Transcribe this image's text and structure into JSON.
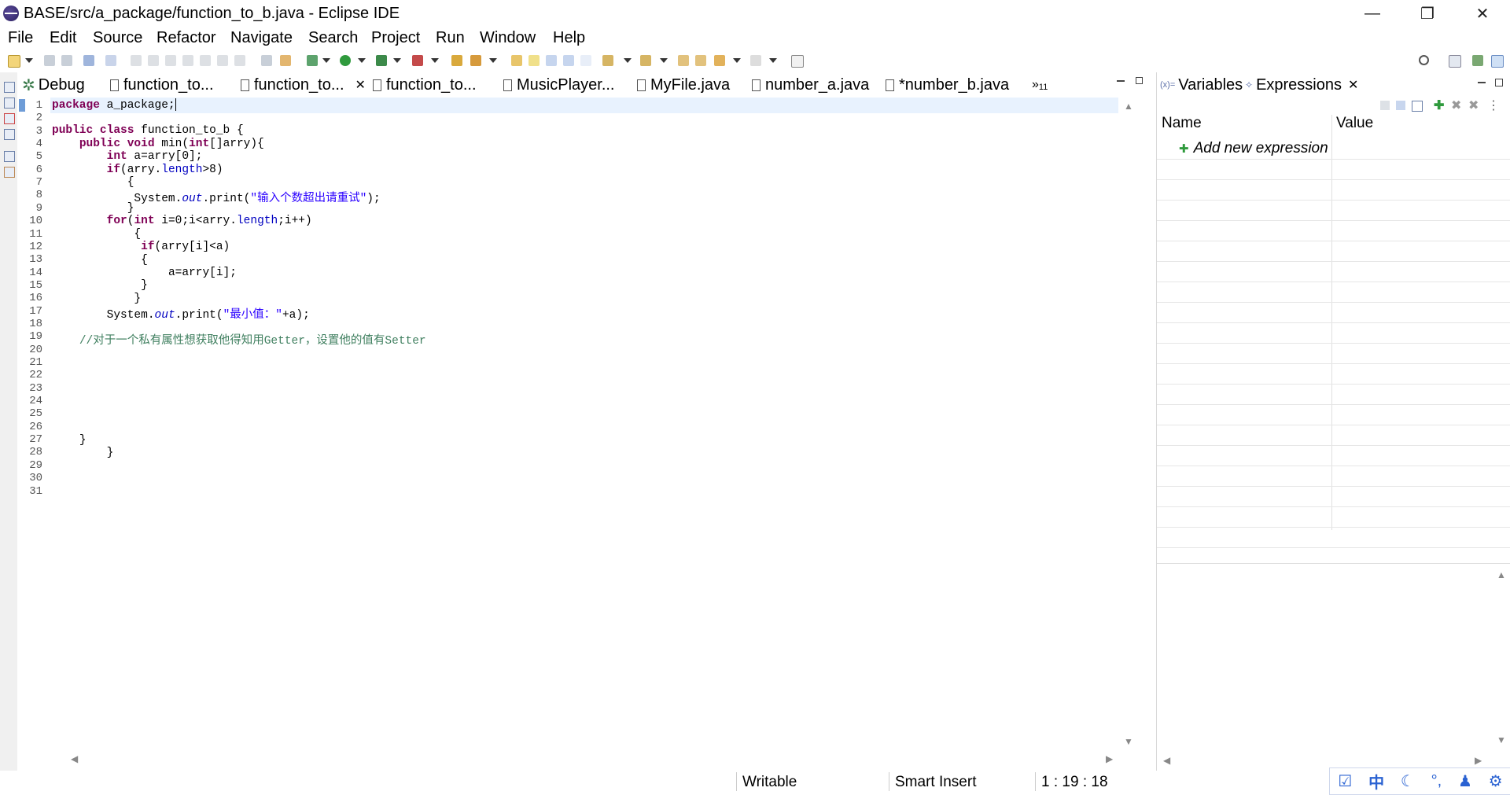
{
  "window": {
    "title": "BASE/src/a_package/function_to_b.java - Eclipse IDE",
    "minimize": "—",
    "restore": "❐",
    "close": "✕"
  },
  "menu": [
    "File",
    "Edit",
    "Source",
    "Refactor",
    "Navigate",
    "Search",
    "Project",
    "Run",
    "Window",
    "Help"
  ],
  "editor_tabs": [
    {
      "label": "Debug",
      "icon": "debug-icon"
    },
    {
      "label": "function_to...",
      "icon": "java-file-icon"
    },
    {
      "label": "function_to...",
      "icon": "java-file-icon",
      "active": true,
      "close": "✕"
    },
    {
      "label": "function_to...",
      "icon": "java-file-icon"
    },
    {
      "label": "MusicPlayer...",
      "icon": "java-file-icon"
    },
    {
      "label": "MyFile.java",
      "icon": "java-file-icon"
    },
    {
      "label": "number_a.java",
      "icon": "java-file-icon"
    },
    {
      "label": "*number_b.java",
      "icon": "java-file-icon"
    }
  ],
  "overflow_tabs": "»",
  "overflow_count": "11",
  "line_numbers": [
    "1",
    "2",
    "3",
    "4",
    "5",
    "6",
    "7",
    "8",
    "9",
    "10",
    "11",
    "12",
    "13",
    "14",
    "15",
    "16",
    "17",
    "18",
    "19",
    "20",
    "21",
    "22",
    "23",
    "24",
    "25",
    "26",
    "27",
    "28",
    "29",
    "30",
    "31"
  ],
  "code": {
    "l1_kw": "package",
    "l1_rest": " a_package;",
    "l3_kw1": "public",
    "l3_kw2": "class",
    "l3_rest": " function_to_b {",
    "l4_kw1": "public",
    "l4_kw2": "void",
    "l4_a": " min(",
    "l4_kw3": "int",
    "l4_b": "[]arry){",
    "l5_kw": "int",
    "l5_rest": " a=arry[0];",
    "l6_kw": "if",
    "l6_a": "(arry.",
    "l6_fld": "length",
    "l6_b": ">8)",
    "l7": "{",
    "l8_a": "System.",
    "l8_fld": "out",
    "l8_b": ".print(",
    "l8_str": "\"输入个数超出请重试\"",
    "l8_c": ");",
    "l9": "}",
    "l10_kw": "for",
    "l10_a": "(",
    "l10_kw2": "int",
    "l10_b": " i=0;i<arry.",
    "l10_fld": "length",
    "l10_c": ";i++)",
    "l11": "{",
    "l12_kw": "if",
    "l12_rest": "(arry[i]<a)",
    "l13": "{",
    "l14": "a=arry[i];",
    "l15": "}",
    "l16": "}",
    "l17_a": "System.",
    "l17_fld": "out",
    "l17_b": ".print(",
    "l17_str": "\"最小值：\"",
    "l17_c": "+a);",
    "l19_cmt": "//对于一个私有属性想获取他得知用Getter，设置他的值有Setter",
    "l27": "}",
    "l28": "}"
  },
  "right_panel": {
    "tabs": [
      {
        "label": "Variables",
        "icon": "variables-icon"
      },
      {
        "label": "Expressions",
        "icon": "expressions-icon",
        "active": true,
        "close": "✕"
      }
    ],
    "columns": [
      "Name",
      "Value"
    ],
    "add_expression": "Add new expression"
  },
  "status": {
    "writable": "Writable",
    "insert_mode": "Smart Insert",
    "position": "1 : 19 : 18"
  },
  "ime": {
    "chinese": "中",
    "punct": "°,"
  },
  "colors": {
    "keyword": "#7f0055",
    "field": "#0000c0",
    "string": "#2a00ff",
    "comment": "#3f7f5f",
    "line_highlight": "#e8f2fe"
  }
}
